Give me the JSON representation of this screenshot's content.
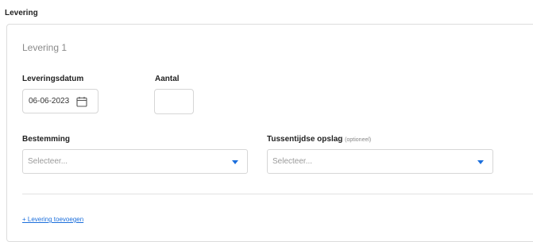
{
  "section": {
    "title": "Levering"
  },
  "delivery": {
    "title": "Levering 1",
    "date_label": "Leveringsdatum",
    "date_value": "06-06-2023",
    "quantity_label": "Aantal",
    "quantity_value": "",
    "destination_label": "Bestemming",
    "destination_placeholder": "Selecteer...",
    "intermediate_label": "Tussentijdse opslag",
    "intermediate_optional": "(optioneel)",
    "intermediate_placeholder": "Selecteer..."
  },
  "actions": {
    "add_delivery": "+ Levering toevoegen"
  },
  "colors": {
    "accent": "#1c6fdc",
    "border": "#d6d6d6"
  },
  "icons": {
    "date": "calendar-icon",
    "select": "caret-down-icon"
  }
}
